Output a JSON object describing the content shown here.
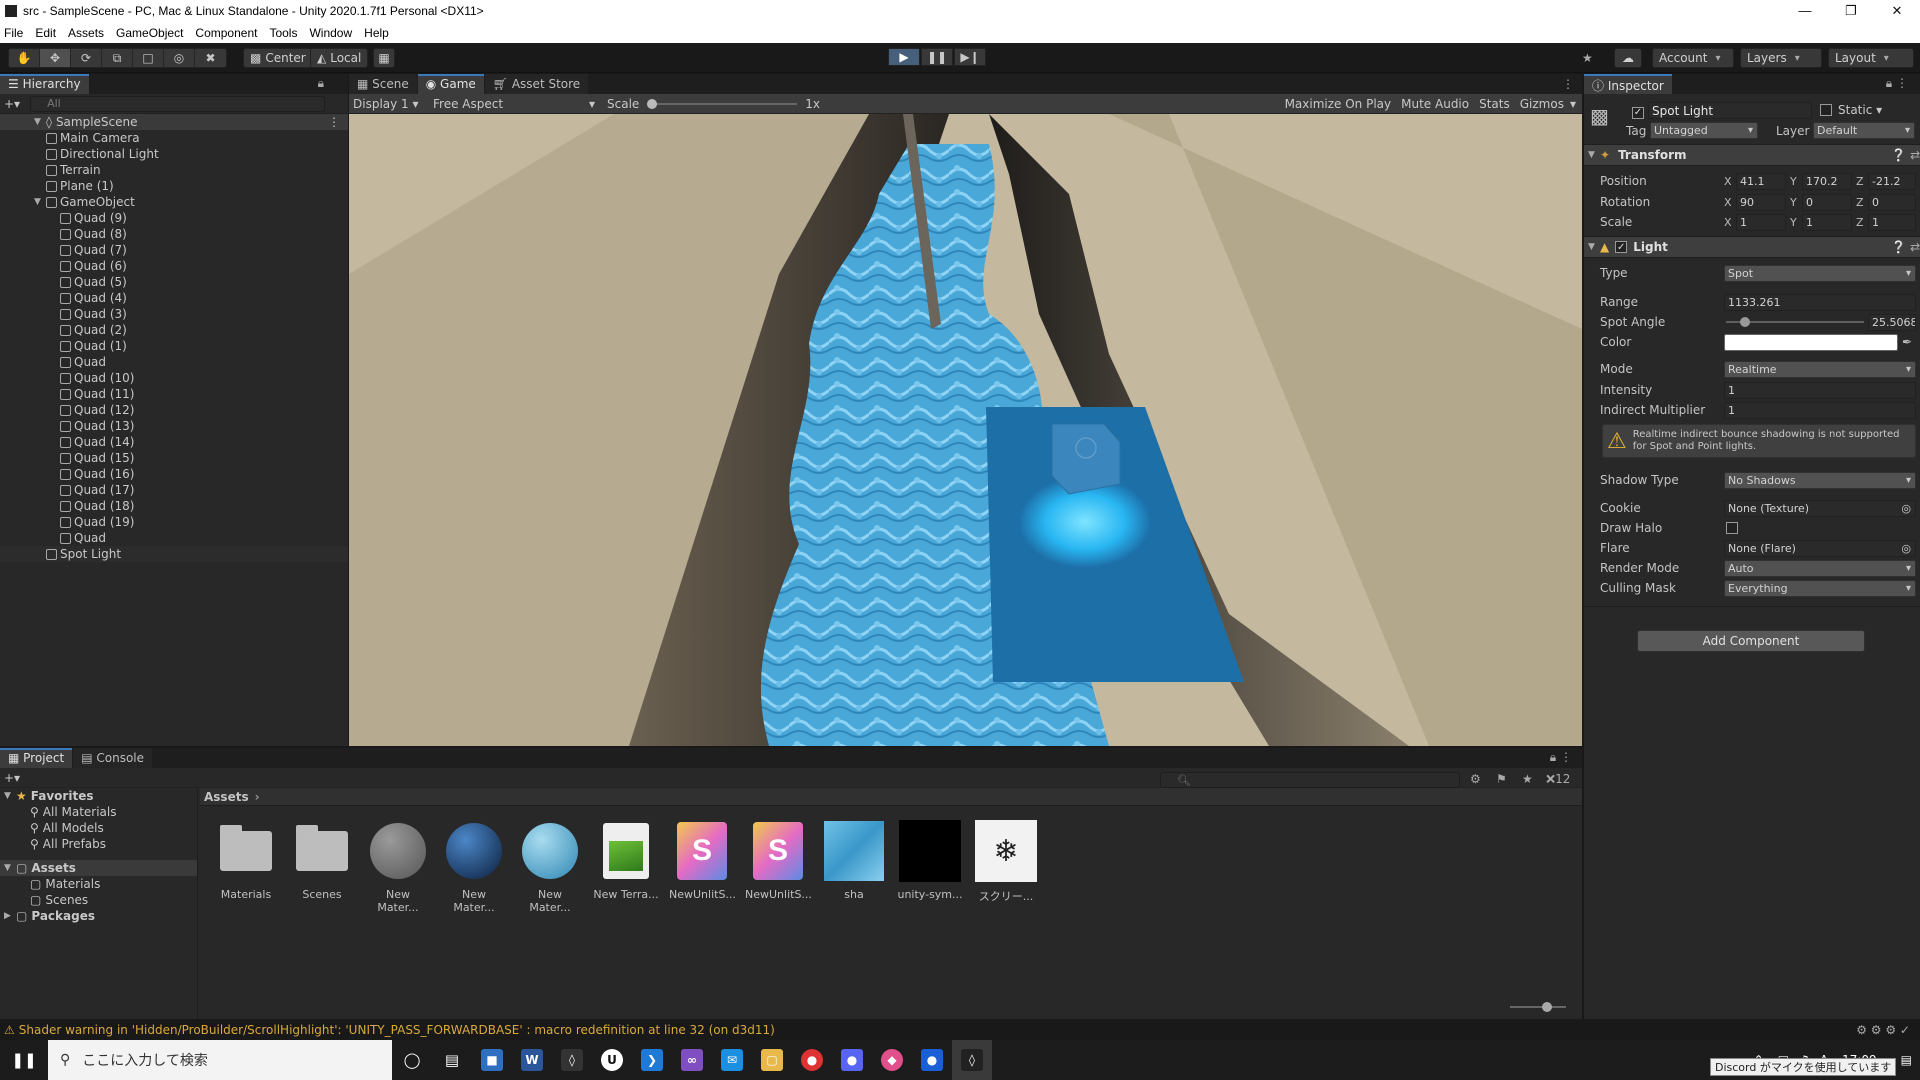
{
  "window": {
    "title": "src - SampleScene - PC, Mac & Linux Standalone - Unity 2020.1.7f1 Personal <DX11>"
  },
  "menu": [
    "File",
    "Edit",
    "Assets",
    "GameObject",
    "Component",
    "Tools",
    "Window",
    "Help"
  ],
  "toolbar": {
    "pivot_label": "Center",
    "space_label": "Local",
    "account_label": "Account",
    "layers_label": "Layers",
    "layout_label": "Layout"
  },
  "hierarchy": {
    "tab_label": "Hierarchy",
    "search_placeholder": "All",
    "scene_name": "SampleScene",
    "items": [
      {
        "label": "Main Camera",
        "depth": 1
      },
      {
        "label": "Directional Light",
        "depth": 1
      },
      {
        "label": "Terrain",
        "depth": 1
      },
      {
        "label": "Plane (1)",
        "depth": 1
      },
      {
        "label": "GameObject",
        "depth": 1,
        "expanded": true
      },
      {
        "label": "Quad (9)",
        "depth": 2
      },
      {
        "label": "Quad (8)",
        "depth": 2
      },
      {
        "label": "Quad (7)",
        "depth": 2
      },
      {
        "label": "Quad (6)",
        "depth": 2
      },
      {
        "label": "Quad (5)",
        "depth": 2
      },
      {
        "label": "Quad (4)",
        "depth": 2
      },
      {
        "label": "Quad (3)",
        "depth": 2
      },
      {
        "label": "Quad (2)",
        "depth": 2
      },
      {
        "label": "Quad (1)",
        "depth": 2
      },
      {
        "label": "Quad",
        "depth": 2
      },
      {
        "label": "Quad (10)",
        "depth": 2
      },
      {
        "label": "Quad (11)",
        "depth": 2
      },
      {
        "label": "Quad (12)",
        "depth": 2
      },
      {
        "label": "Quad (13)",
        "depth": 2
      },
      {
        "label": "Quad (14)",
        "depth": 2
      },
      {
        "label": "Quad (15)",
        "depth": 2
      },
      {
        "label": "Quad (16)",
        "depth": 2
      },
      {
        "label": "Quad (17)",
        "depth": 2
      },
      {
        "label": "Quad (18)",
        "depth": 2
      },
      {
        "label": "Quad (19)",
        "depth": 2
      },
      {
        "label": "Quad",
        "depth": 2
      },
      {
        "label": "Spot Light",
        "depth": 1,
        "selected": true
      }
    ]
  },
  "game_view": {
    "tabs": [
      "Scene",
      "Game",
      "Asset Store"
    ],
    "active_tab": "Game",
    "display": "Display 1",
    "aspect": "Free Aspect",
    "scale_label": "Scale",
    "scale_value": "1x",
    "maximize": "Maximize On Play",
    "mute": "Mute Audio",
    "stats": "Stats",
    "gizmos": "Gizmos"
  },
  "inspector": {
    "tab_label": "Inspector",
    "object_name": "Spot Light",
    "static_label": "Static",
    "tag_label": "Tag",
    "tag_value": "Untagged",
    "layer_label": "Layer",
    "layer_value": "Default",
    "transform": {
      "title": "Transform",
      "position": {
        "label": "Position",
        "x": "41.1",
        "y": "170.2",
        "z": "-21.2"
      },
      "rotation": {
        "label": "Rotation",
        "x": "90",
        "y": "0",
        "z": "0"
      },
      "scale": {
        "label": "Scale",
        "x": "1",
        "y": "1",
        "z": "1"
      }
    },
    "light": {
      "title": "Light",
      "type_label": "Type",
      "type_value": "Spot",
      "range_label": "Range",
      "range_value": "1133.261",
      "spot_angle_label": "Spot Angle",
      "spot_angle_value": "25.5068",
      "spot_angle_slider": 0.14,
      "color_label": "Color",
      "color_value": "#ffffff",
      "mode_label": "Mode",
      "mode_value": "Realtime",
      "intensity_label": "Intensity",
      "intensity_value": "1",
      "indirect_label": "Indirect Multiplier",
      "indirect_value": "1",
      "warning": "Realtime indirect bounce shadowing is not supported for Spot and Point lights.",
      "shadow_label": "Shadow Type",
      "shadow_value": "No Shadows",
      "cookie_label": "Cookie",
      "cookie_value": "None (Texture)",
      "halo_label": "Draw Halo",
      "flare_label": "Flare",
      "flare_value": "None (Flare)",
      "render_mode_label": "Render Mode",
      "render_mode_value": "Auto",
      "culling_label": "Culling Mask",
      "culling_value": "Everything"
    },
    "add_component": "Add Component"
  },
  "project": {
    "tabs": [
      "Project",
      "Console"
    ],
    "hidden_count": "12",
    "favorites_label": "Favorites",
    "favorites": [
      "All Materials",
      "All Models",
      "All Prefabs"
    ],
    "assets_label": "Assets",
    "asset_folders": [
      "Materials",
      "Scenes"
    ],
    "packages_label": "Packages",
    "breadcrumb": "Assets",
    "items": [
      {
        "label": "Materials",
        "kind": "folder"
      },
      {
        "label": "Scenes",
        "kind": "folder"
      },
      {
        "label": "New Mater...",
        "kind": "sphere-grey"
      },
      {
        "label": "New Mater...",
        "kind": "sphere-blue"
      },
      {
        "label": "New Mater...",
        "kind": "sphere-water"
      },
      {
        "label": "New Terra...",
        "kind": "terrain"
      },
      {
        "label": "NewUnlitS...",
        "kind": "shader"
      },
      {
        "label": "NewUnlitS...",
        "kind": "shader"
      },
      {
        "label": "sha",
        "kind": "water-texture"
      },
      {
        "label": "unity-sym...",
        "kind": "black-texture"
      },
      {
        "label": "スクリー...",
        "kind": "unity-logo"
      }
    ]
  },
  "status": {
    "message": "Shader warning in 'Hidden/ProBuilder/ScrollHighlight': 'UNITY_PASS_FORWARDBASE' : macro redefinition at line 32 (on d3d11)"
  },
  "taskbar": {
    "search_placeholder": "ここに入力して検索",
    "clock": "17:09",
    "notification": "Discord がマイクを使用しています"
  },
  "colors": {
    "accent": "#3a79bb",
    "play_active": "#46607c",
    "warning": "#d9a93a",
    "water": "#4aa8d8",
    "terrain": "#b7aa90"
  }
}
